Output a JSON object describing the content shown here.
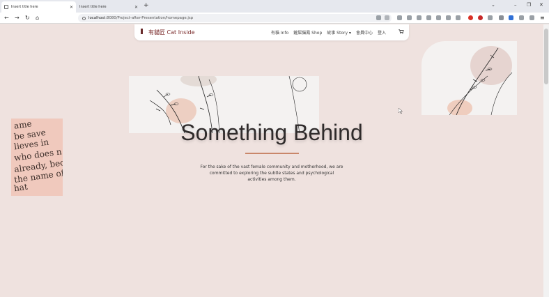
{
  "browser": {
    "tabs": [
      {
        "title": "Insert title here",
        "active": true
      },
      {
        "title": "Insert title here",
        "active": false
      }
    ],
    "new_tab_label": "+",
    "url": {
      "host": "localhost",
      "path": ":8080/Project-after-Presentation/homepage.jsp"
    },
    "window_controls": {
      "minimize": "–",
      "restore": "❐",
      "close": "✕"
    },
    "nav": {
      "back": "←",
      "forward": "→",
      "reload": "↻",
      "home": "⌂"
    },
    "menu_label": "≡"
  },
  "site": {
    "logo_text": "有貓匠 Cat Inside",
    "nav": [
      "有貓 Info",
      "鏟屎貓鳳 Shop",
      "故事 Story ▾",
      "會員中心",
      "登入"
    ]
  },
  "hero": {
    "title": "Something Behind",
    "description": "For the sake of the vast female community and motherhood, we are committed to exploring the subtle states and psychological activities among them."
  },
  "book_image": {
    "lines": [
      "ame",
      "be save",
      "lieves in",
      "who does n",
      "already, becau",
      "the name of",
      "hat"
    ]
  },
  "colors": {
    "page_bg": "#efe2df",
    "accent": "#c9876a",
    "logo": "#7a2a2a"
  }
}
